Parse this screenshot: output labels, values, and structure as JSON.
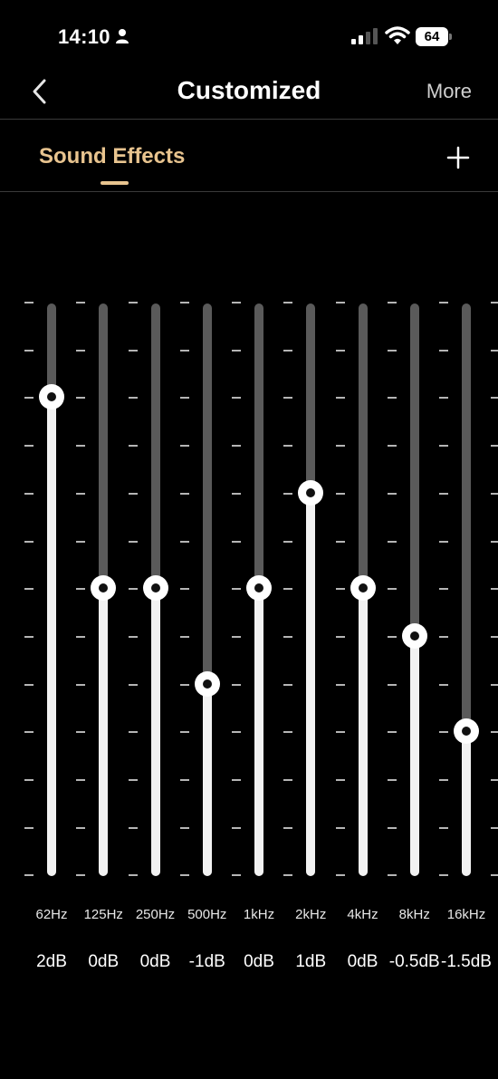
{
  "status_bar": {
    "time": "14:10",
    "battery": "64"
  },
  "nav": {
    "title": "Customized",
    "more_label": "More"
  },
  "tabs": {
    "active_label": "Sound Effects",
    "accent_color": "#e8c48f"
  },
  "equalizer": {
    "levels": 12,
    "bands": [
      {
        "freq": "62Hz",
        "gain": "2dB",
        "level": 10
      },
      {
        "freq": "125Hz",
        "gain": "0dB",
        "level": 6
      },
      {
        "freq": "250Hz",
        "gain": "0dB",
        "level": 6
      },
      {
        "freq": "500Hz",
        "gain": "-1dB",
        "level": 4
      },
      {
        "freq": "1kHz",
        "gain": "0dB",
        "level": 6
      },
      {
        "freq": "2kHz",
        "gain": "1dB",
        "level": 8
      },
      {
        "freq": "4kHz",
        "gain": "0dB",
        "level": 6
      },
      {
        "freq": "8kHz",
        "gain": "-0.5dB",
        "level": 5
      },
      {
        "freq": "16kHz",
        "gain": "-1.5dB",
        "level": 3
      }
    ]
  }
}
